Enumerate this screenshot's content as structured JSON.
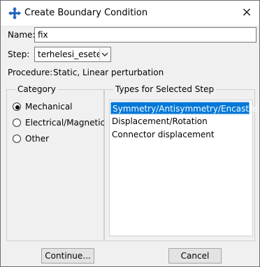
{
  "window": {
    "title": "Create Boundary Condition",
    "close_glyph": "×",
    "icon": "boundary-condition-icon"
  },
  "name": {
    "label": "Name:",
    "value": "fix"
  },
  "step": {
    "label": "Step:",
    "value": "terhelesi_esetek"
  },
  "procedure": {
    "label": "Procedure:",
    "value": "Static, Linear perturbation"
  },
  "category": {
    "title": "Category",
    "options": [
      {
        "label": "Mechanical",
        "selected": true
      },
      {
        "label": "Electrical/Magnetic",
        "selected": false
      },
      {
        "label": "Other",
        "selected": false
      }
    ]
  },
  "types": {
    "title": "Types for Selected Step",
    "items": [
      {
        "label": "Symmetry/Antisymmetry/Encastre",
        "selected": true
      },
      {
        "label": "Displacement/Rotation",
        "selected": false
      },
      {
        "label": "Connector displacement",
        "selected": false
      }
    ]
  },
  "buttons": {
    "continue": "Continue...",
    "cancel": "Cancel"
  },
  "colors": {
    "selection": "#0078d7",
    "dialog_background": "#f0f0f0",
    "title_background": "#ffffff"
  }
}
